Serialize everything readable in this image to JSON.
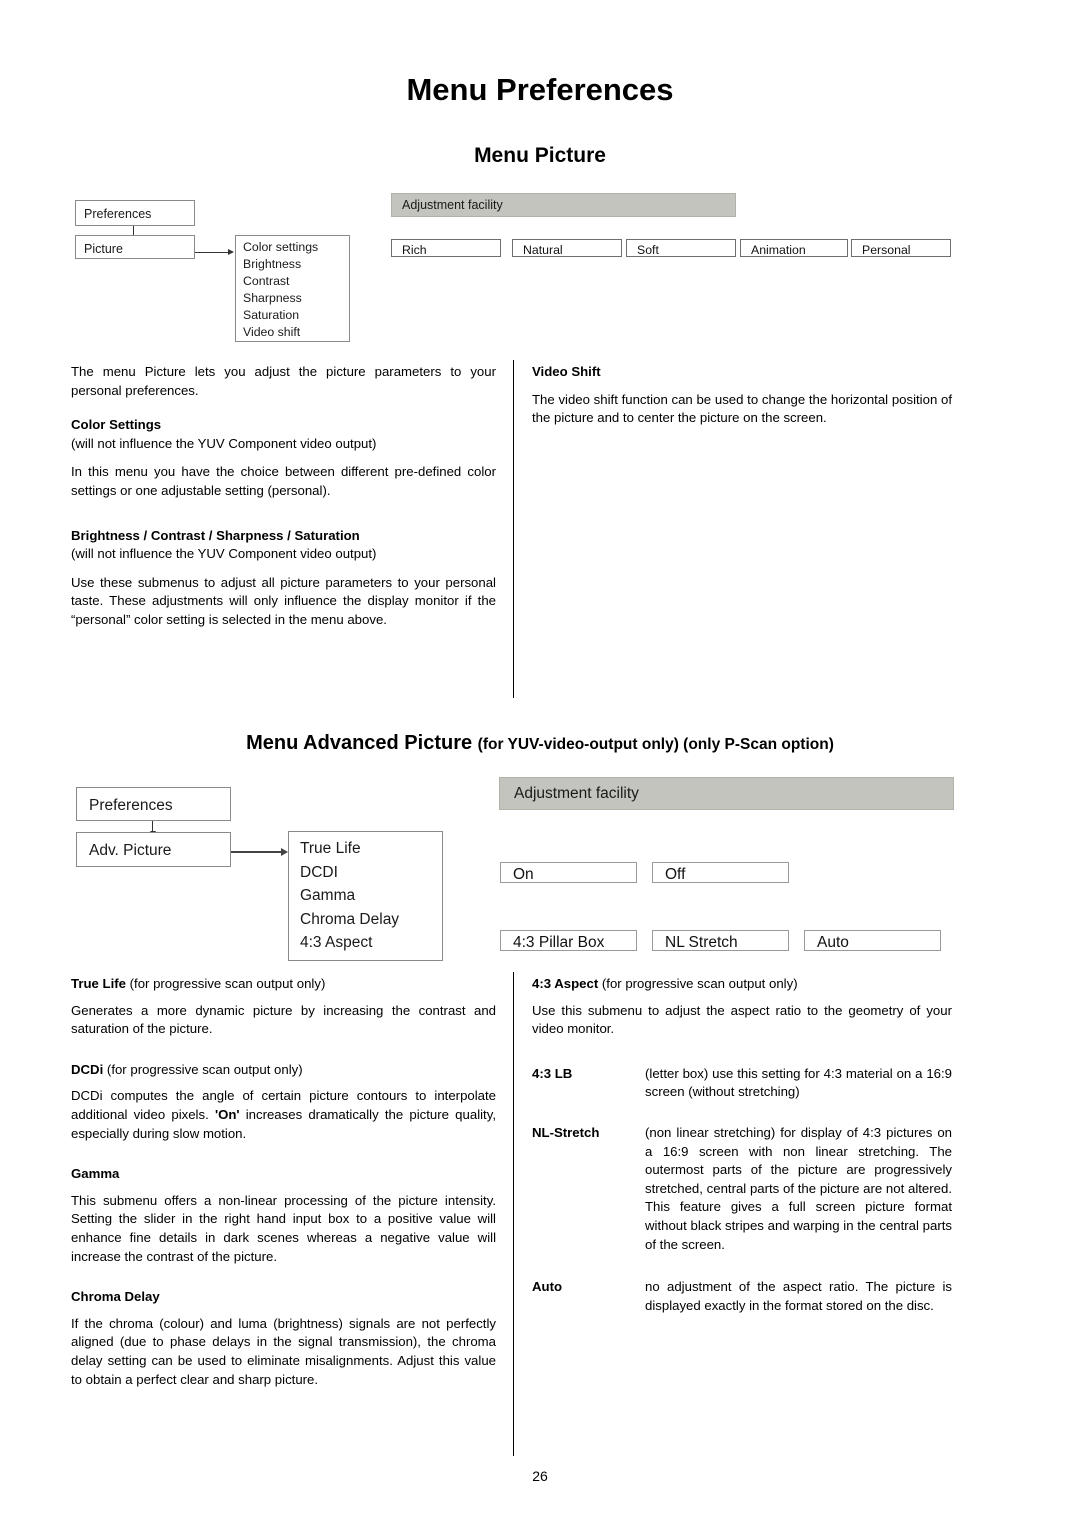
{
  "document": {
    "page_title": "Menu Preferences",
    "page_number": "26",
    "colors": {
      "adjustment_bar": "#c4c4be",
      "box_border": "#8a8a86",
      "text": "#000000"
    }
  },
  "menu_picture": {
    "heading": "Menu Picture",
    "diagram": {
      "nodes": {
        "preferences": "Preferences",
        "picture": "Picture"
      },
      "submenu_items": [
        "Color settings",
        "Brightness",
        "Contrast",
        "Sharpness",
        "Saturation",
        "Video shift"
      ],
      "adjustment_bar_label": "Adjustment facility",
      "preset_options": [
        "Rich",
        "Natural",
        "Soft",
        "Animation",
        "Personal"
      ]
    },
    "left_column": {
      "intro": "The menu Picture lets you adjust the picture parameters to your personal preferences.",
      "color_settings_heading": "Color Settings",
      "color_settings_note": "(will not influence the YUV Component video output)",
      "color_settings_body": "In this menu you have the choice between different pre-defined color settings or one adjustable setting (personal).",
      "bcss_heading": "Brightness / Contrast / Sharpness / Saturation",
      "bcss_note": "(will not influence the YUV Component video output)",
      "bcss_body": "Use these submenus to adjust all picture parameters to your personal taste. These adjustments will only influence the display monitor if the “personal” color setting is selected in the menu above."
    },
    "right_column": {
      "video_shift_heading": "Video Shift",
      "video_shift_body": "The video shift function can be used to change the horizontal position of the picture and to center the picture on the screen."
    }
  },
  "menu_advanced_picture": {
    "heading_main": "Menu Advanced Picture",
    "heading_sub": "(for YUV-video-output only) (only P-Scan option)",
    "diagram": {
      "nodes": {
        "preferences": "Preferences",
        "adv_picture": "Adv. Picture"
      },
      "submenu_items": [
        "True Life",
        "DCDI",
        "Gamma",
        "Chroma Delay",
        "4:3 Aspect"
      ],
      "adjustment_bar_label": "Adjustment facility",
      "toggle_options": [
        "On",
        "Off"
      ],
      "aspect_options": [
        "4:3 Pillar Box",
        "NL Stretch",
        "Auto"
      ]
    },
    "left_column": {
      "true_life_heading": "True Life",
      "true_life_note": "(for progressive scan output only)",
      "true_life_body": "Generates a more dynamic picture by increasing the contrast and saturation of the picture.",
      "dcdi_heading": "DCDi",
      "dcdi_note": "(for progressive scan output only)",
      "dcdi_body_part1": "DCDi computes the angle of certain picture contours to interpolate additional video pixels. ",
      "dcdi_body_emphasis": "'On'",
      "dcdi_body_part2": " increases dramatically the picture quality, especially during slow motion.",
      "gamma_heading": "Gamma",
      "gamma_body": "This submenu offers a non-linear processing of the picture intensity. Setting the slider in the right hand input box to a positive value will enhance fine details in dark scenes whereas a negative value will increase the contrast of the picture.",
      "chroma_delay_heading": "Chroma Delay",
      "chroma_delay_body": "If the chroma (colour) and luma (brightness) signals are not perfectly aligned (due to phase delays in the signal transmission), the chroma delay setting can be used to eliminate misalignments. Adjust this value to obtain a perfect clear and sharp picture."
    },
    "right_column": {
      "aspect_heading": "4:3 Aspect",
      "aspect_note": "(for progressive scan output only)",
      "aspect_body": "Use this submenu to adjust the aspect ratio to the geometry of your video monitor.",
      "definitions": [
        {
          "term": "4:3 LB",
          "desc": "(letter box) use this setting for 4:3 material on a 16:9 screen (without stretching)"
        },
        {
          "term": "NL-Stretch",
          "desc": "(non linear stretching) for display of 4:3 pictures on a 16:9 screen with non linear stretching. The outermost parts of the picture are progressively stretched, central parts of the picture are not altered. This feature gives a full screen picture format without black stripes and warping in the central parts of the screen."
        },
        {
          "term": "Auto",
          "desc": "no adjustment of the aspect ratio. The picture is displayed exactly in the format stored on the disc."
        }
      ]
    }
  }
}
